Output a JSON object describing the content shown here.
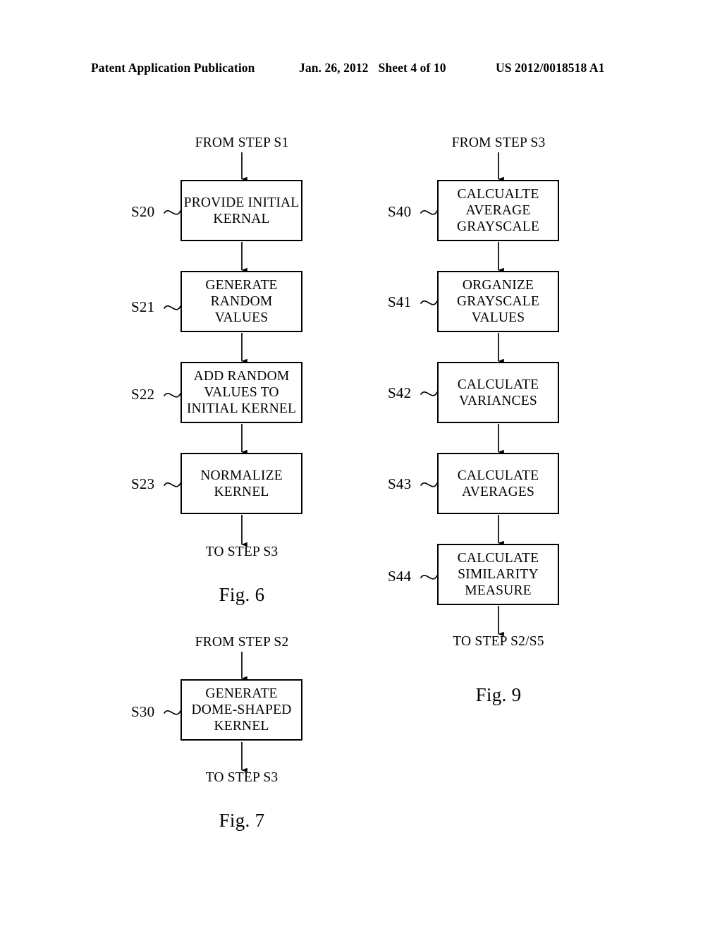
{
  "header": {
    "publication": "Patent Application Publication",
    "date": "Jan. 26, 2012",
    "sheet": "Sheet 4 of 10",
    "patent_number": "US 2012/0018518 A1"
  },
  "figures": [
    {
      "id": "fig6",
      "caption": "Fig. 6",
      "entry_label": "FROM STEP S1",
      "exit_label": "TO STEP S3",
      "steps": [
        {
          "ref": "S20",
          "text": "PROVIDE INITIAL\nKERNAL"
        },
        {
          "ref": "S21",
          "text": "GENERATE\nRANDOM\nVALUES"
        },
        {
          "ref": "S22",
          "text": "ADD RANDOM\nVALUES TO\nINITIAL KERNEL"
        },
        {
          "ref": "S23",
          "text": "NORMALIZE\nKERNEL"
        }
      ]
    },
    {
      "id": "fig7",
      "caption": "Fig. 7",
      "entry_label": "FROM STEP S2",
      "exit_label": "TO STEP S3",
      "steps": [
        {
          "ref": "S30",
          "text": "GENERATE\nDOME-SHAPED\nKERNEL"
        }
      ]
    },
    {
      "id": "fig9",
      "caption": "Fig. 9",
      "entry_label": "FROM STEP S3",
      "exit_label": "TO STEP S2/S5",
      "steps": [
        {
          "ref": "S40",
          "text": "CALCUALTE\nAVERAGE\nGRAYSCALE"
        },
        {
          "ref": "S41",
          "text": "ORGANIZE\nGRAYSCALE\nVALUES"
        },
        {
          "ref": "S42",
          "text": "CALCULATE\nVARIANCES"
        },
        {
          "ref": "S43",
          "text": "CALCULATE\nAVERAGES"
        },
        {
          "ref": "S44",
          "text": "CALCULATE\nSIMILARITY\nMEASURE"
        }
      ]
    }
  ],
  "colors": {
    "ink": "#000000",
    "paper": "#ffffff"
  }
}
